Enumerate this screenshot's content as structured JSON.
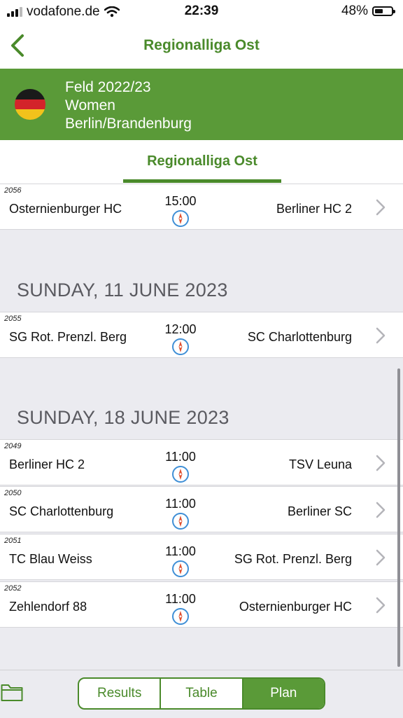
{
  "status": {
    "carrier": "vodafone.de",
    "time": "22:39",
    "battery": "48%",
    "battery_level": 0.48
  },
  "nav": {
    "title": "Regionalliga Ost",
    "back_icon": "chevron-left-icon"
  },
  "banner": {
    "season": "Feld 2022/23",
    "category": "Women",
    "region": "Berlin/Brandenburg",
    "flag_icon": "germany-flag-icon"
  },
  "tab": {
    "title": "Regionalliga Ost"
  },
  "schedule": {
    "first_game": {
      "no": "2056",
      "home": "Osternienburger HC",
      "time": "15:00",
      "away": "Berliner HC 2"
    },
    "days": [
      {
        "date": "SUNDAY, 11 JUNE 2023",
        "games": [
          {
            "no": "2055",
            "home": "SG Rot. Prenzl. Berg",
            "time": "12:00",
            "away": "SC Charlottenburg"
          }
        ]
      },
      {
        "date": "SUNDAY, 18 JUNE 2023",
        "games": [
          {
            "no": "2049",
            "home": "Berliner HC 2",
            "time": "11:00",
            "away": "TSV Leuna"
          },
          {
            "no": "2050",
            "home": "SC Charlottenburg",
            "time": "11:00",
            "away": "Berliner SC"
          },
          {
            "no": "2051",
            "home": "TC Blau Weiss",
            "time": "11:00",
            "away": "SG Rot. Prenzl. Berg"
          },
          {
            "no": "2052",
            "home": "Zehlendorf 88",
            "time": "11:00",
            "away": "Osternienburger HC"
          }
        ]
      }
    ]
  },
  "bottom": {
    "results": "Results",
    "table": "Table",
    "plan": "Plan",
    "active": "Plan"
  },
  "colors": {
    "accent": "#4a8a2b",
    "banner": "#5a9a38"
  }
}
